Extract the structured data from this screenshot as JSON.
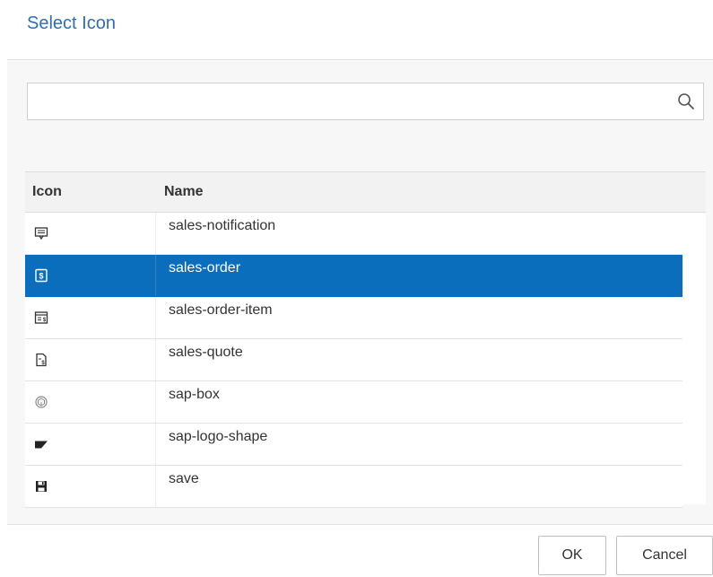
{
  "dialog": {
    "title": "Select Icon"
  },
  "search": {
    "value": "",
    "placeholder": "",
    "icon": "search-icon"
  },
  "table": {
    "columns": {
      "icon": "Icon",
      "name": "Name"
    },
    "rows": [
      {
        "icon": "sales-notification-icon",
        "name": "sales-notification",
        "selected": false
      },
      {
        "icon": "sales-order-icon",
        "name": "sales-order",
        "selected": true
      },
      {
        "icon": "sales-order-item-icon",
        "name": "sales-order-item",
        "selected": false
      },
      {
        "icon": "sales-quote-icon",
        "name": "sales-quote",
        "selected": false
      },
      {
        "icon": "sap-box-icon",
        "name": "sap-box",
        "selected": false
      },
      {
        "icon": "sap-logo-shape-icon",
        "name": "sap-logo-shape",
        "selected": false
      },
      {
        "icon": "save-icon",
        "name": "save",
        "selected": false
      }
    ]
  },
  "footer": {
    "ok_label": "OK",
    "cancel_label": "Cancel"
  },
  "colors": {
    "title": "#2e6fae",
    "selection": "#0a6ebd"
  }
}
